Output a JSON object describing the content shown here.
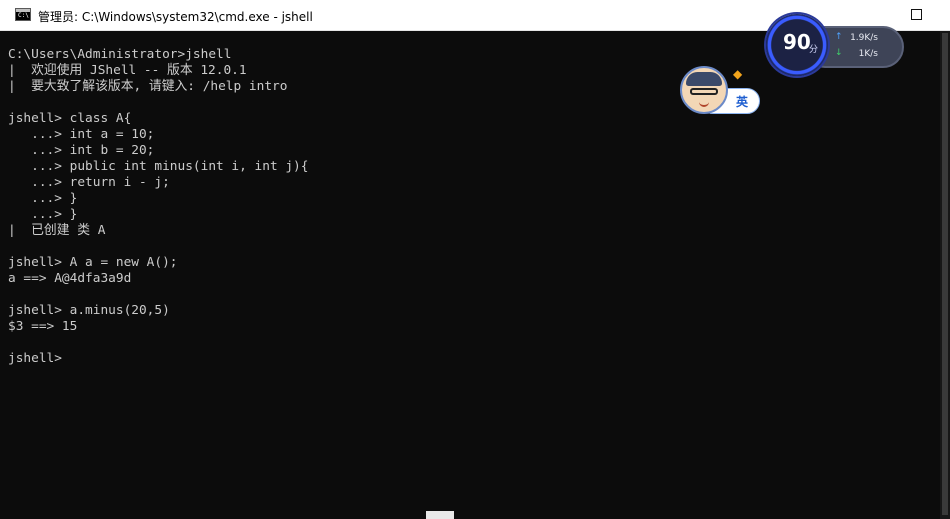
{
  "window": {
    "title": "管理员: C:\\Windows\\system32\\cmd.exe - jshell",
    "icon_label": "C:\\"
  },
  "controls": {
    "minimize_glyph": "—",
    "maximize_icon": "maximize-square"
  },
  "terminal": {
    "text": "C:\\Users\\Administrator>jshell\n|  欢迎使用 JShell -- 版本 12.0.1\n|  要大致了解该版本, 请键入: /help intro\n\njshell> class A{\n   ...> int a = 10;\n   ...> int b = 20;\n   ...> public int minus(int i, int j){\n   ...> return i - j;\n   ...> }\n   ...> }\n|  已创建 类 A\n\njshell> A a = new A();\na ==> A@4dfa3a9d\n\njshell> a.minus(20,5)\n$3 ==> 15\n\njshell>",
    "text_color": "#cccccc",
    "background": "#0c0c0c"
  },
  "speed_widget": {
    "score": "90",
    "score_unit": "分",
    "upload_arrow": "↑",
    "download_arrow": "↓",
    "upload_rate": "1.9K/s",
    "download_rate": "1K/s"
  },
  "ime_widget": {
    "label": "英",
    "badge_icon": "diamond-icon"
  }
}
